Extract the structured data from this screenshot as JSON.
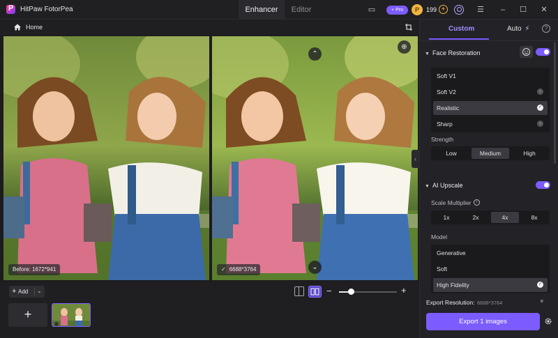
{
  "titlebar": {
    "app_title": "HitPaw FotorPea",
    "tabs": [
      "Enhancer",
      "Editor"
    ],
    "pro_label": "+ Pro",
    "credits": "199",
    "credit_plus": "+",
    "minimize": "–",
    "maximize": "☐",
    "close": "✕",
    "menu": "☰",
    "chat": "▭"
  },
  "workspace": {
    "home_label": "Home",
    "before_label": "Before: 1672*941",
    "after_label": "6688*3764",
    "after_check": "✓",
    "scroll_up": "⌃",
    "scroll_down": "⌄",
    "zoom_glyph": "⊕",
    "handle": "‹"
  },
  "bottombar": {
    "add_plus": "+",
    "add_label": "Add",
    "add_chevron": "⌄",
    "add_tile": "+",
    "zoom_minus": "−",
    "zoom_plus": "+",
    "zoom_level": 0.2
  },
  "panel": {
    "tab_custom": "Custom",
    "tab_auto": "Auto",
    "auto_glyph": "⚡",
    "help": "?",
    "face_restoration": {
      "title": "Face Restoration",
      "enabled": true,
      "models": [
        {
          "label": "Soft V1",
          "icon": ""
        },
        {
          "label": "Soft V2",
          "icon": "↓"
        },
        {
          "label": "Realistic",
          "icon": "✓",
          "selected": true
        },
        {
          "label": "Sharp",
          "icon": "↓"
        }
      ],
      "strength_label": "Strength",
      "strength_options": [
        "Low",
        "Medium",
        "High"
      ],
      "strength_selected": "Medium"
    },
    "ai_upscale": {
      "title": "AI Upscale",
      "enabled": true,
      "scale_label": "Scale Multiplier",
      "info": "i",
      "scale_options": [
        "1x",
        "2x",
        "4x",
        "8x"
      ],
      "scale_selected": "4x",
      "model_label": "Model",
      "models": [
        {
          "label": "Generative",
          "icon": ""
        },
        {
          "label": "Soft",
          "icon": ""
        },
        {
          "label": "High Fidelity",
          "icon": "✓",
          "selected": true
        }
      ]
    },
    "export_resolution_label": "Export Resolution:",
    "export_resolution_value": "6688*3764",
    "export_chevron": "»",
    "export_button": "Export 1 images"
  },
  "colors": {
    "accent": "#7c5cff",
    "background": "#1c1c1f",
    "panel": "#232327"
  }
}
